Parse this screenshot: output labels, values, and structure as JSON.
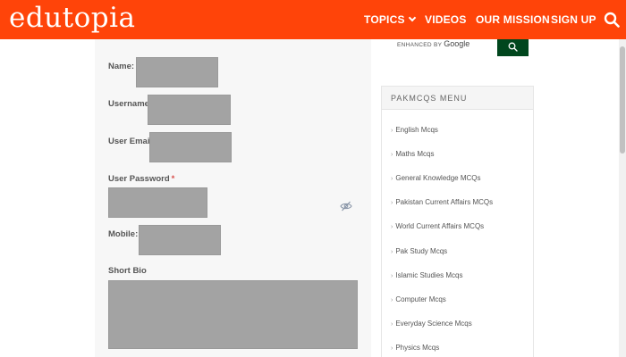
{
  "header": {
    "logo": "edutopia",
    "nav": {
      "topics": "TOPICS",
      "videos": "VIDEOS",
      "our_mission": "OUR MISSION",
      "sign_up": "SIGN UP"
    },
    "icons": {
      "topics_chevron": "chevron-down-icon",
      "search": "search-icon"
    },
    "brand_color": "#ff4409"
  },
  "form": {
    "name_label": "Name:",
    "username_label": "Username",
    "email_label": "User Email",
    "password_label": "User Password",
    "mobile_label": "Mobile:",
    "bio_label": "Short Bio",
    "required_mark": "*",
    "password_toggle_icon": "eye-slash-icon"
  },
  "sidebar": {
    "search": {
      "enhanced_by": "ENHANCED BY",
      "google": "Google",
      "button_icon": "search-icon",
      "button_color": "#00461d"
    },
    "menu": {
      "title": "PAKMCQS MENU",
      "items": [
        "English Mcqs",
        "Maths Mcqs",
        "General Knowledge MCQs",
        "Pakistan Current Affairs MCQs",
        "World Current Affairs MCQs",
        "Pak Study Mcqs",
        "Islamic Studies Mcqs",
        "Computer Mcqs",
        "Everyday Science Mcqs",
        "Physics Mcqs"
      ]
    }
  }
}
